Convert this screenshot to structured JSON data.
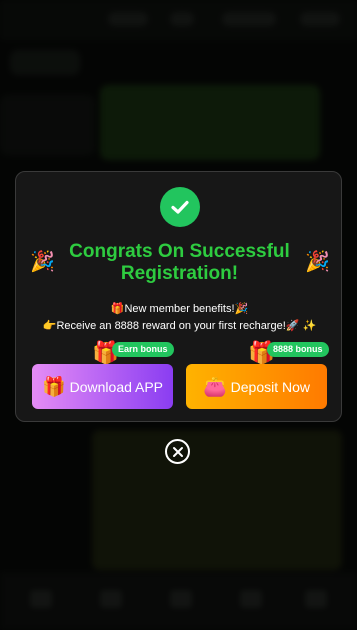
{
  "modal": {
    "title": "Congrats On Successful Registration!",
    "benefit_line": "🎁New member benefits!🎉",
    "reward_line": "👉Receive an 8888 reward on your first recharge!🚀 ✨",
    "badges": {
      "download": "Earn bonus",
      "deposit": "8888 bonus"
    },
    "buttons": {
      "download_label": "Download APP",
      "deposit_label": "Deposit Now"
    },
    "icons": {
      "success": "check-circle-icon",
      "party": "party-popper-icon",
      "gift": "gift-icon",
      "wallet": "wallet-icon",
      "close": "close-icon"
    }
  },
  "colors": {
    "accent_green": "#2ecc40",
    "download_gradient": [
      "#e58cf5",
      "#8a3df2"
    ],
    "deposit_gradient": [
      "#ffb300",
      "#ff7a00"
    ]
  }
}
